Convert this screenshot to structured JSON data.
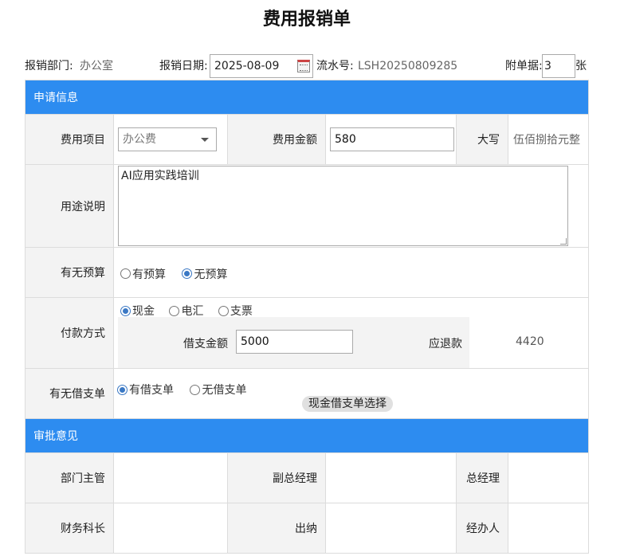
{
  "title": "费用报销单",
  "header": {
    "dept_label": "报销部门:",
    "dept_value": "办公室",
    "date_label": "报销日期:",
    "date_value": "2025-08-09",
    "serial_label": "流水号:",
    "serial_value": "LSH20250809285",
    "attach_label": "附单据:",
    "attach_value": "3",
    "attach_unit": "张"
  },
  "apply_section": {
    "title": "申请信息",
    "expense_item_label": "费用项目",
    "expense_item_value": "办公费",
    "amount_label": "费用金额",
    "amount_value": "580",
    "upper_label": "大写",
    "upper_value": "伍佰捌拾元整",
    "purpose_label": "用途说明",
    "purpose_value": "AI应用实践培训",
    "budget_label": "有无预算",
    "budget_options": [
      "有预算",
      "无预算"
    ],
    "budget_selected": "无预算",
    "payment_label": "付款方式",
    "payment_options": [
      "现金",
      "电汇",
      "支票"
    ],
    "payment_selected": "现金",
    "loan_amount_label": "借支金额",
    "loan_amount_value": "5000",
    "refund_label": "应退款",
    "refund_value": "4420",
    "loan_label": "有无借支单",
    "loan_options": [
      "有借支单",
      "无借支单"
    ],
    "loan_selected": "有借支单",
    "loan_select_button": "现金借支单选择"
  },
  "approve_section": {
    "title": "审批意见",
    "dept_manager": "部门主管",
    "vice_gm": "副总经理",
    "gm": "总经理",
    "finance_chief": "财务科长",
    "cashier": "出纳",
    "handler": "经办人"
  }
}
